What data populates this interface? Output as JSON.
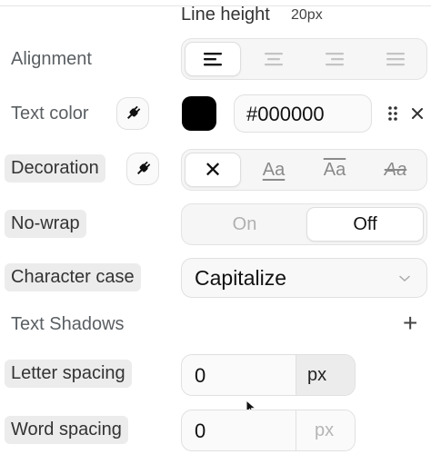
{
  "line_height": {
    "label": "Line height",
    "value": "20px"
  },
  "alignment": {
    "label": "Alignment",
    "options": [
      "align-left",
      "align-center",
      "align-right",
      "align-justify"
    ],
    "active_index": 0
  },
  "text_color": {
    "label": "Text color",
    "swatch": "#000000",
    "hex": "#000000"
  },
  "decoration": {
    "label": "Decoration",
    "none_glyph": "✕",
    "underline_sample": "Aa",
    "overline_sample": "Aa",
    "strike_sample": "Aa",
    "active_index": 0
  },
  "no_wrap": {
    "label": "No-wrap",
    "on_label": "On",
    "off_label": "Off",
    "active": "off"
  },
  "character_case": {
    "label": "Character case",
    "value": "Capitalize"
  },
  "text_shadows": {
    "label": "Text Shadows",
    "add_glyph": "+"
  },
  "letter_spacing": {
    "label": "Letter spacing",
    "value": "0",
    "unit": "px"
  },
  "word_spacing": {
    "label": "Word spacing",
    "value": "0",
    "unit": "px"
  },
  "colors": {
    "label_gray": "#5a5f63",
    "chip_bg": "#ececec",
    "control_bg": "#f6f6f6"
  }
}
